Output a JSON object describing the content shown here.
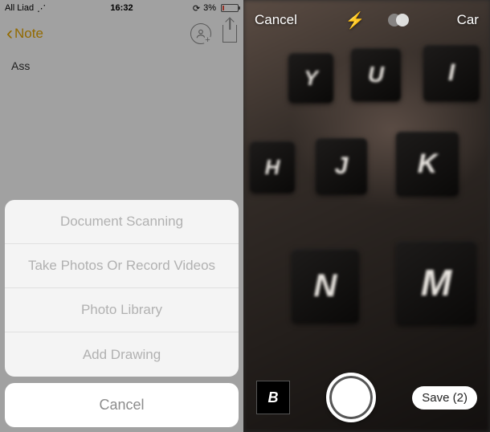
{
  "left": {
    "status": {
      "carrier": "All Liad",
      "time": "16:32",
      "battery_pct": "3%"
    },
    "nav": {
      "back_label": "Note"
    },
    "note_text": "Ass",
    "sheet": {
      "items": [
        "Document Scanning",
        "Take Photos Or Record Videos",
        "Photo Library",
        "Add Drawing"
      ],
      "cancel": "Cancel"
    }
  },
  "right": {
    "top": {
      "cancel": "Cancel",
      "mode_right": "Car"
    },
    "bottom": {
      "thumb_letter": "B",
      "save_label": "Save (2)"
    },
    "visible_keys": [
      "Y",
      "U",
      "I",
      "H",
      "J",
      "K",
      "N",
      "M"
    ]
  }
}
